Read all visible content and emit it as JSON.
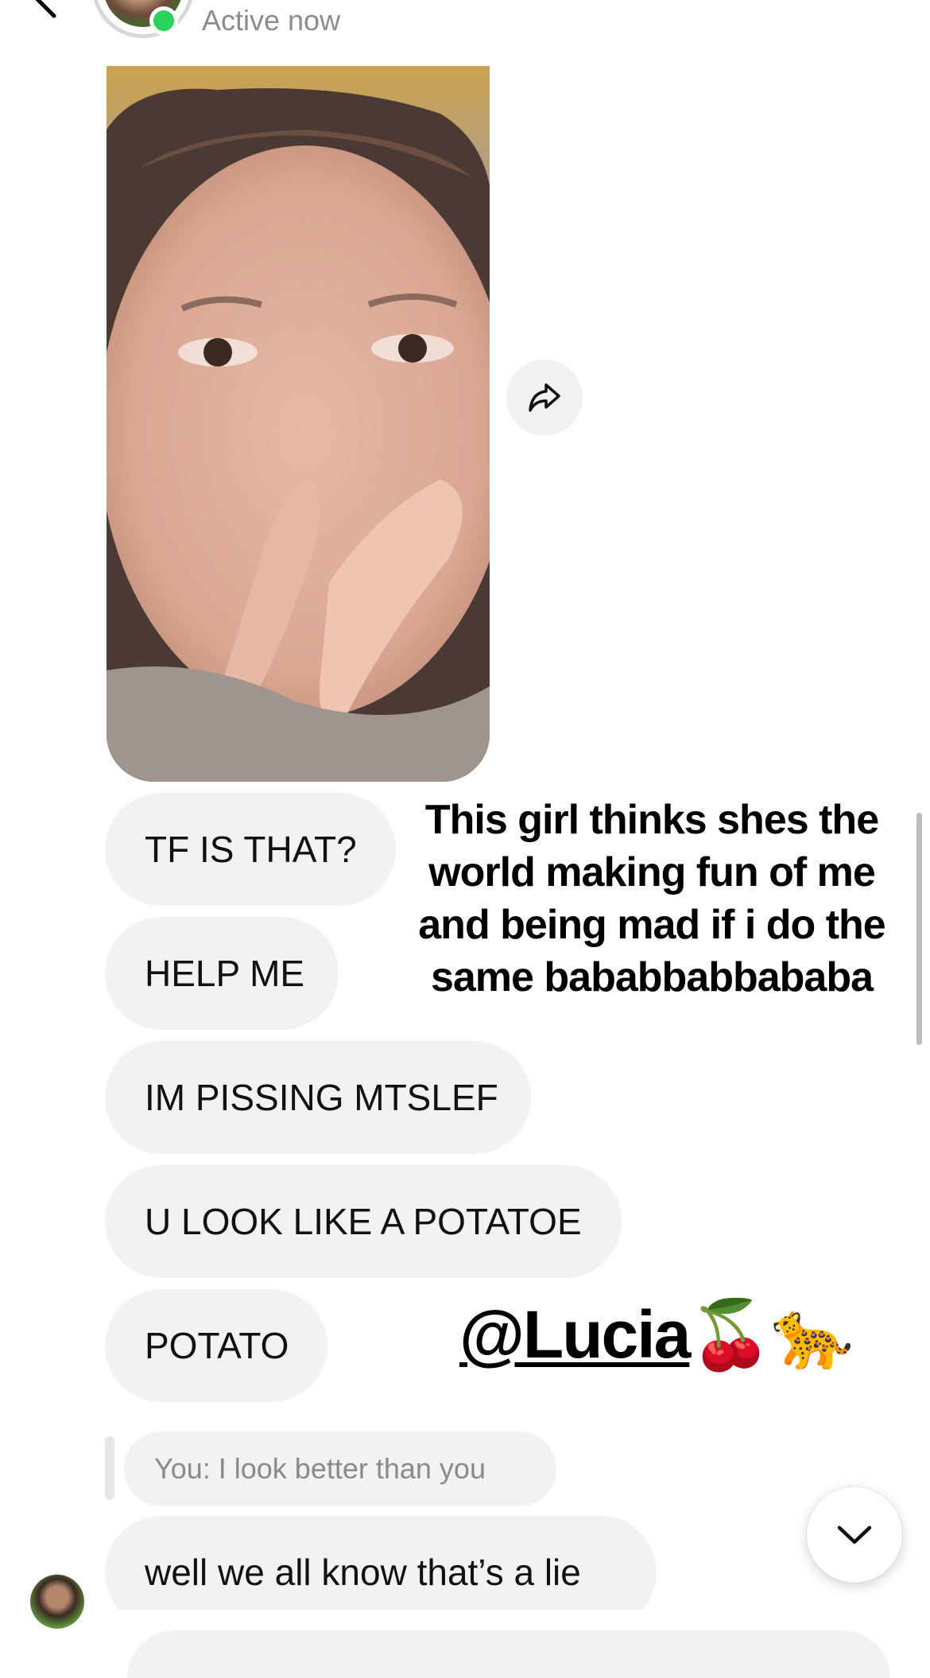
{
  "header": {
    "status": "Active now",
    "back_icon": "chevron-left-icon",
    "more_icon": "ellipsis-icon"
  },
  "media": {
    "type": "photo",
    "share_icon": "share-arrow-icon"
  },
  "messages": [
    {
      "text": "TF IS THAT?"
    },
    {
      "text": "HELP ME"
    },
    {
      "text": "IM PISSING MTSLEF"
    },
    {
      "text": "U LOOK LIKE A POTATOE"
    },
    {
      "text": "POTATO"
    }
  ],
  "overlay": {
    "caption": "This girl thinks shes the world making fun of me and being mad if i do the same bababbabbababa",
    "handle": "@Lucia",
    "handle_emojis": "🍒🐆"
  },
  "reply": {
    "quoted": "You: I look better than you",
    "text": "well we all know that’s a lie"
  },
  "controls": {
    "scroll_down_icon": "chevron-down-icon"
  },
  "colors": {
    "online": "#2ad15a",
    "bubble": "#f2f2f2",
    "muted_text": "#8c8c8c"
  }
}
